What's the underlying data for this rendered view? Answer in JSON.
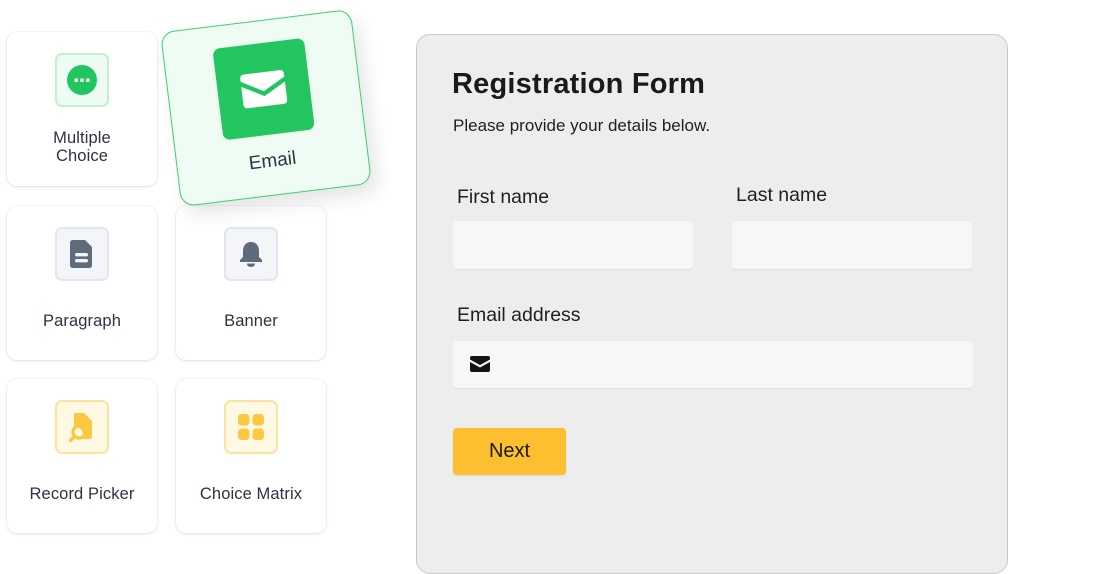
{
  "palette": {
    "items": [
      {
        "id": "multiple-choice",
        "label": "Multiple Choice",
        "line1": "Multiple",
        "line2": "Choice",
        "icon": "dots-circle-icon"
      },
      {
        "id": "email",
        "label": "Email",
        "icon": "envelope-icon",
        "state": "dragging"
      },
      {
        "id": "paragraph",
        "label": "Paragraph",
        "icon": "document-icon"
      },
      {
        "id": "banner",
        "label": "Banner",
        "icon": "bell-icon"
      },
      {
        "id": "record-picker",
        "label": "Record Picker",
        "icon": "record-search-icon"
      },
      {
        "id": "choice-matrix",
        "label": "Choice Matrix",
        "icon": "grid-icon"
      }
    ]
  },
  "form": {
    "title": "Registration Form",
    "subtitle": "Please provide your details below.",
    "fields": {
      "first_name": {
        "label": "First name",
        "value": "",
        "placeholder": ""
      },
      "last_name": {
        "label": "Last name",
        "value": "",
        "placeholder": ""
      },
      "email": {
        "label": "Email address",
        "value": "",
        "placeholder": "",
        "icon": "envelope-icon"
      }
    },
    "next_label": "Next"
  },
  "colors": {
    "green_accent": "#22c55e",
    "yellow_accent": "#fbbf2f",
    "gray_icon": "#5f6b7d",
    "form_bg": "#ededed"
  }
}
